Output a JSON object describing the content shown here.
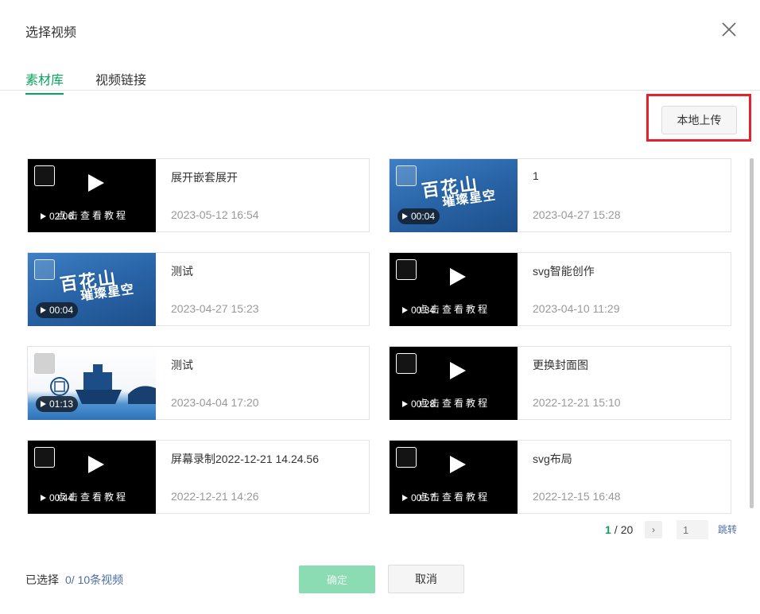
{
  "dialog": {
    "title": "选择视频"
  },
  "tabs": [
    {
      "label": "素材库",
      "active": true
    },
    {
      "label": "视频链接",
      "active": false
    }
  ],
  "toolbar": {
    "upload_label": "本地上传"
  },
  "watermark_text": "点击查看教程",
  "blue_art": {
    "line1": "百花山",
    "line2": "璀璨星空"
  },
  "videos": [
    {
      "name": "展开嵌套展开",
      "date": "2023-05-12 16:54",
      "duration": "02:06",
      "thumbnail": "black"
    },
    {
      "name": "1",
      "date": "2023-04-27 15:28",
      "duration": "00:04",
      "thumbnail": "blue"
    },
    {
      "name": "测试",
      "date": "2023-04-27 15:23",
      "duration": "00:04",
      "thumbnail": "blue"
    },
    {
      "name": "svg智能创作",
      "date": "2023-04-10 11:29",
      "duration": "00:34",
      "thumbnail": "black"
    },
    {
      "name": "测试",
      "date": "2023-04-04 17:20",
      "duration": "01:13",
      "thumbnail": "illustration"
    },
    {
      "name": "更换封面图",
      "date": "2022-12-21 15:10",
      "duration": "00:28",
      "thumbnail": "black"
    },
    {
      "name": "屏幕录制2022-12-21 14.24.56",
      "date": "2022-12-21 14:26",
      "duration": "00:44",
      "thumbnail": "black"
    },
    {
      "name": "svg布局",
      "date": "2022-12-15 16:48",
      "duration": "00:57",
      "thumbnail": "black"
    }
  ],
  "pagination": {
    "current": "1",
    "separator": "/",
    "total": "20",
    "input_placeholder": "1",
    "jump_label": "跳转"
  },
  "footer": {
    "selected_label": "已选择",
    "selected_count": "0/ 10条视频",
    "confirm_label": "确定",
    "cancel_label": "取消"
  },
  "colors": {
    "accent": "#07a45b",
    "highlight": "#e8202b",
    "link": "#4a6fa5"
  },
  "icons": {
    "close": "close-icon",
    "play": "play-icon",
    "next": "chevron-right-icon"
  }
}
